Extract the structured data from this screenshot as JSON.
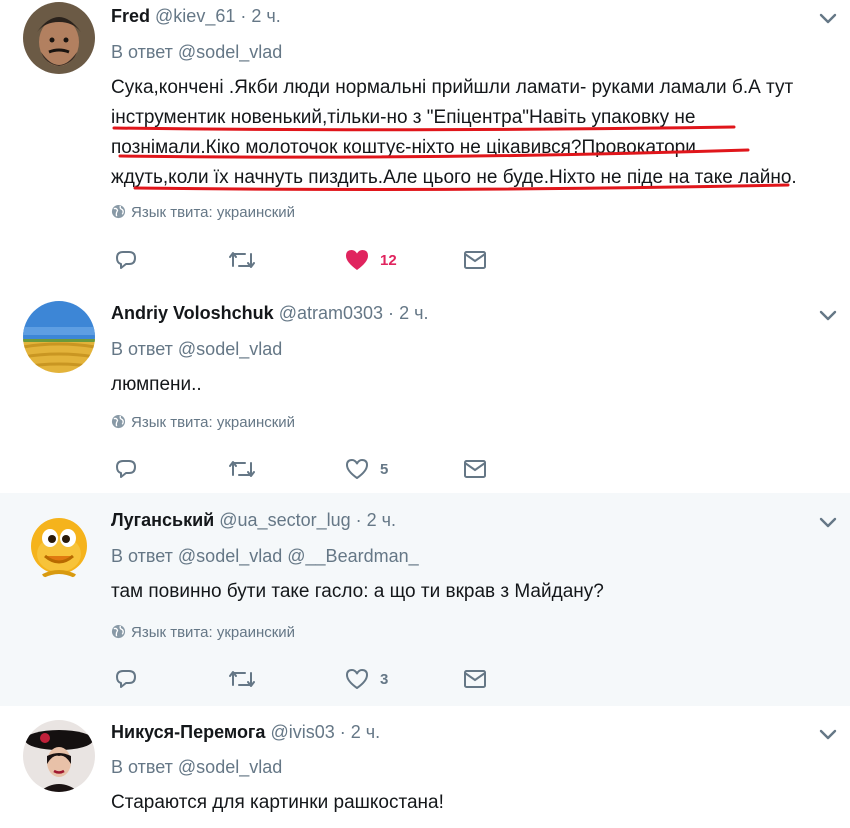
{
  "tweets": [
    {
      "name": "Fred",
      "handle": "@kiev_61",
      "dot": "·",
      "time": "2 ч.",
      "reply_prefix": "В ответ",
      "reply_to": "@sodel_vlad",
      "reply_to2": "",
      "lines": [
        "Сука,кончені .Якби люди нормальні прийшли ламати- руками ламали б.А тут",
        "інструментик новенький,тільки-но з \"Епіцентра\"Навіть упаковку не",
        "познімали.Кіко молоточок коштує-ніхто не цікавився?Провокатори",
        "ждуть,коли їх начнуть пиздить.Але цього не буде.Ніхто не піде на таке лайно."
      ],
      "lang": "Язык твита: украинский",
      "likes": "12"
    },
    {
      "name": "Andriy Voloshchuk",
      "handle": "@atram0303",
      "dot": "·",
      "time": "2 ч.",
      "reply_prefix": "В ответ",
      "reply_to": "@sodel_vlad",
      "reply_to2": "",
      "lines": [
        "люмпени.."
      ],
      "lang": "Язык твита: украинский",
      "likes": "5"
    },
    {
      "name": "Луганський",
      "handle": "@ua_sector_lug",
      "dot": "·",
      "time": "2 ч.",
      "reply_prefix": "В ответ",
      "reply_to": "@sodel_vlad",
      "reply_to2": "@__Beardman_",
      "lines": [
        "там повинно бути таке гасло: а що ти вкрав з Майдану?"
      ],
      "lang": "Язык твита: украинский",
      "likes": "3"
    },
    {
      "name": "Никуся-Перемога",
      "handle": "@ivis03",
      "dot": "·",
      "time": "2 ч.",
      "reply_prefix": "В ответ",
      "reply_to": "@sodel_vlad",
      "reply_to2": "",
      "lines": [
        "Стараются для картинки рашкостана!"
      ]
    }
  ],
  "colors": {
    "name": "#14171a",
    "muted": "#657786",
    "like_active": "#e0245e",
    "highlight_row": "#f5f8fa",
    "annotation_red": "#e0161b"
  },
  "icons": [
    "chevron-down-icon",
    "globe-icon",
    "reply-icon",
    "retweet-icon",
    "heart-icon",
    "heart-filled-icon",
    "direct-message-icon"
  ]
}
